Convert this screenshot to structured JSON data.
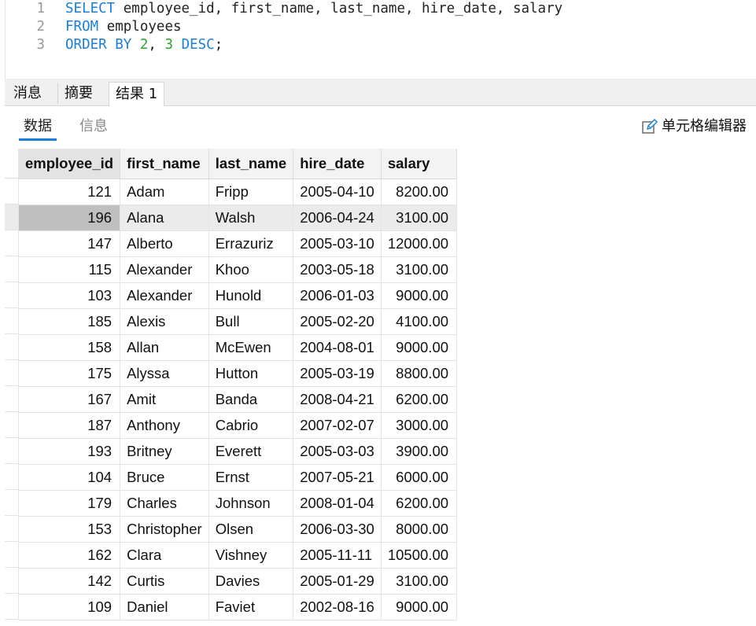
{
  "editor": {
    "lines": [
      {
        "num": "1",
        "tokens": [
          {
            "t": "SELECT",
            "c": "kw"
          },
          {
            "t": " employee_id, first_name, last_name, hire_date, salary",
            "c": "id"
          }
        ]
      },
      {
        "num": "2",
        "tokens": [
          {
            "t": "FROM",
            "c": "kw"
          },
          {
            "t": " employees",
            "c": "id"
          }
        ]
      },
      {
        "num": "3",
        "tokens": [
          {
            "t": "ORDER BY",
            "c": "kw"
          },
          {
            "t": " ",
            "c": "id"
          },
          {
            "t": "2",
            "c": "num"
          },
          {
            "t": ", ",
            "c": "id"
          },
          {
            "t": "3",
            "c": "num"
          },
          {
            "t": " ",
            "c": "id"
          },
          {
            "t": "DESC",
            "c": "kw"
          },
          {
            "t": ";",
            "c": "id"
          }
        ]
      }
    ]
  },
  "tabs": [
    {
      "label": "消息",
      "active": false
    },
    {
      "label": "摘要",
      "active": false
    },
    {
      "label": "结果 1",
      "active": true
    }
  ],
  "subtabs": {
    "data_label": "数据",
    "info_label": "信息",
    "cell_editor_label": "单元格编辑器"
  },
  "colors": {
    "keyword": "#1a7fd8",
    "number": "#2ba42b",
    "selected_row": "#ebebeb",
    "active_cell": "#bfbfbf"
  },
  "grid": {
    "columns": [
      "employee_id",
      "first_name",
      "last_name",
      "hire_date",
      "salary"
    ],
    "selected_row_index": 1,
    "rows": [
      [
        "121",
        "Adam",
        "Fripp",
        "2005-04-10",
        "8200.00"
      ],
      [
        "196",
        "Alana",
        "Walsh",
        "2006-04-24",
        "3100.00"
      ],
      [
        "147",
        "Alberto",
        "Errazuriz",
        "2005-03-10",
        "12000.00"
      ],
      [
        "115",
        "Alexander",
        "Khoo",
        "2003-05-18",
        "3100.00"
      ],
      [
        "103",
        "Alexander",
        "Hunold",
        "2006-01-03",
        "9000.00"
      ],
      [
        "185",
        "Alexis",
        "Bull",
        "2005-02-20",
        "4100.00"
      ],
      [
        "158",
        "Allan",
        "McEwen",
        "2004-08-01",
        "9000.00"
      ],
      [
        "175",
        "Alyssa",
        "Hutton",
        "2005-03-19",
        "8800.00"
      ],
      [
        "167",
        "Amit",
        "Banda",
        "2008-04-21",
        "6200.00"
      ],
      [
        "187",
        "Anthony",
        "Cabrio",
        "2007-02-07",
        "3000.00"
      ],
      [
        "193",
        "Britney",
        "Everett",
        "2005-03-03",
        "3900.00"
      ],
      [
        "104",
        "Bruce",
        "Ernst",
        "2007-05-21",
        "6000.00"
      ],
      [
        "179",
        "Charles",
        "Johnson",
        "2008-01-04",
        "6200.00"
      ],
      [
        "153",
        "Christopher",
        "Olsen",
        "2006-03-30",
        "8000.00"
      ],
      [
        "162",
        "Clara",
        "Vishney",
        "2005-11-11",
        "10500.00"
      ],
      [
        "142",
        "Curtis",
        "Davies",
        "2005-01-29",
        "3100.00"
      ],
      [
        "109",
        "Daniel",
        "Faviet",
        "2002-08-16",
        "9000.00"
      ]
    ]
  }
}
